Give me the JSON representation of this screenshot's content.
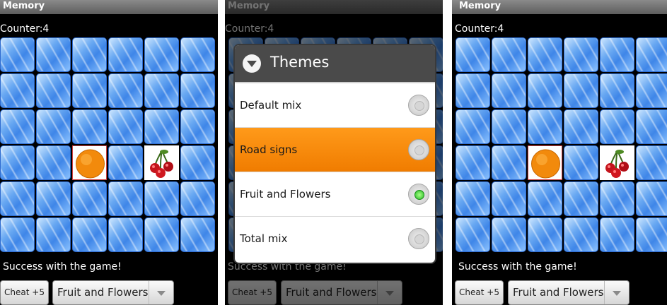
{
  "app": {
    "title": "Memory"
  },
  "counter_text": "Counter:4",
  "success_text": "Success with the game!",
  "cheat_label": "Cheat +5",
  "theme_selected": "Fruit and Flowers",
  "cards": {
    "orange": "orange",
    "cherry": "cherry"
  },
  "dialog": {
    "title": "Themes",
    "options": [
      {
        "label": "Default mix",
        "checked": false
      },
      {
        "label": "Road signs",
        "checked": false,
        "highlighted": true
      },
      {
        "label": "Fruit and Flowers",
        "checked": true
      },
      {
        "label": "Total mix",
        "checked": false
      }
    ]
  },
  "colors": {
    "highlight": "#f58a0a",
    "tile_blue": "#4a8ee8",
    "radio_on": "#22bb22"
  }
}
